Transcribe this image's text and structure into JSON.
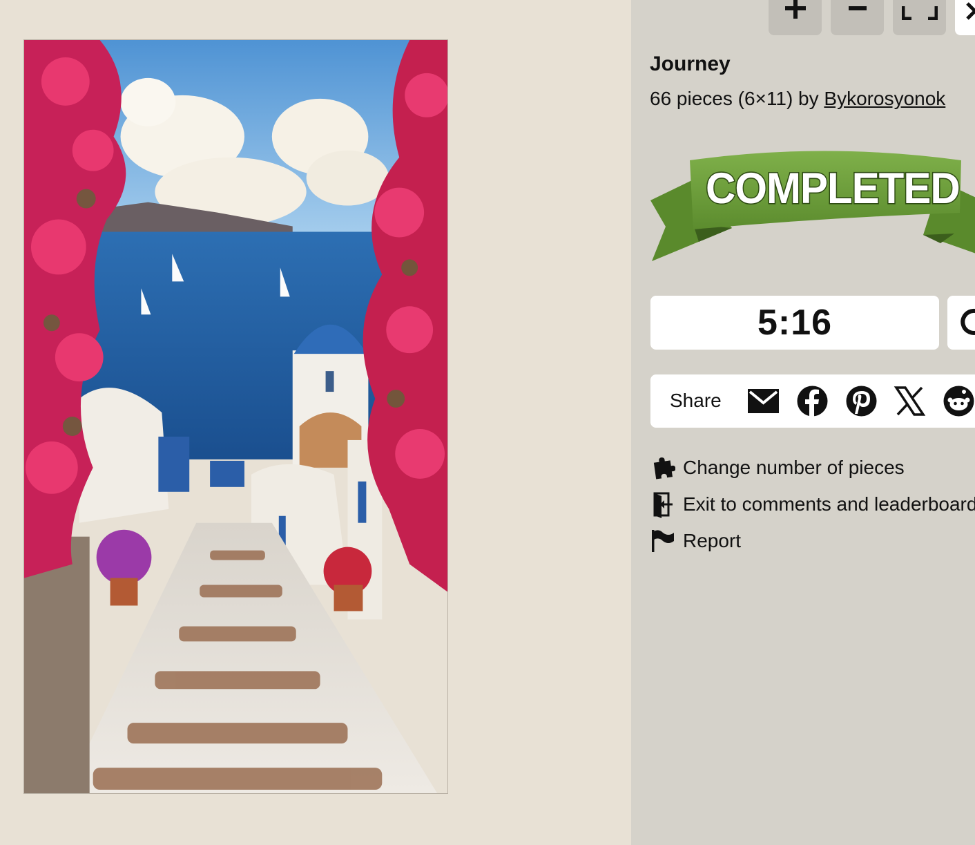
{
  "toolbar": {
    "zoom_in_icon": "plus-icon",
    "zoom_out_icon": "minus-icon",
    "fullscreen_icon": "fullscreen-icon",
    "close_icon": "close-icon"
  },
  "puzzle": {
    "title": "Journey",
    "meta_prefix": "66 pieces (6×11) by ",
    "author": "Bykorosyonok",
    "image_icon": "santorini-stairway-image"
  },
  "status": {
    "banner_text": "COMPLETED",
    "banner_color": "#6a9a3a"
  },
  "timer": {
    "value": "5:16",
    "restart_icon": "restart-icon"
  },
  "share": {
    "label": "Share",
    "icons": [
      "email-icon",
      "facebook-icon",
      "pinterest-icon",
      "x-icon",
      "reddit-icon"
    ]
  },
  "menu": {
    "items": [
      {
        "label": "Change number of pieces",
        "icon": "puzzle-piece-icon"
      },
      {
        "label": "Exit to comments and leaderboard",
        "icon": "exit-door-icon"
      },
      {
        "label": "Report",
        "icon": "flag-icon"
      }
    ]
  },
  "colors": {
    "board_background": "#e8e1d5",
    "panel_background": "#d5d2ca",
    "card_background": "#ffffff"
  }
}
